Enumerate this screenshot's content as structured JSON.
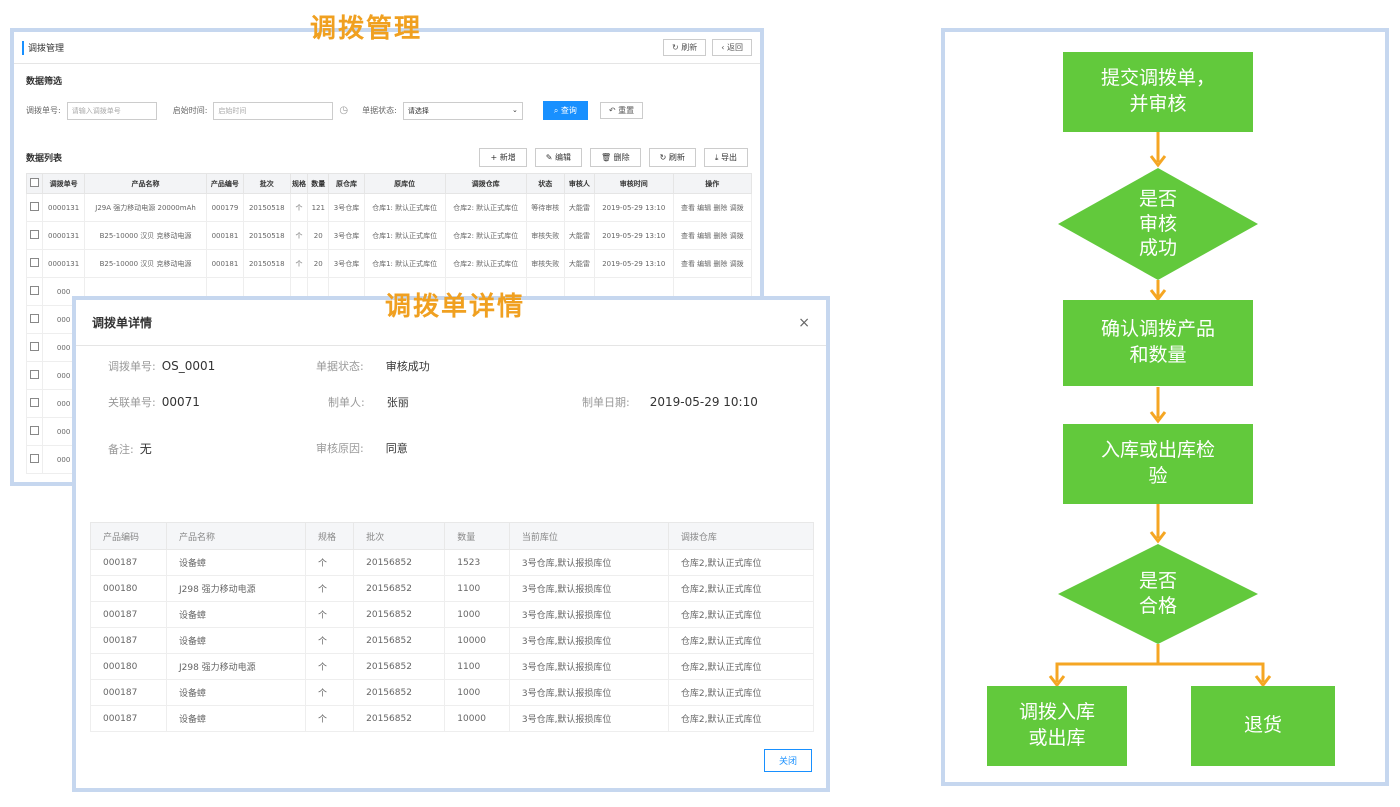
{
  "captions": {
    "top": "调拨管理",
    "middle": "调拨单详情"
  },
  "back_window": {
    "title": "调拨管理",
    "refresh": "刷新",
    "back": "返回",
    "filter_section": "数据筛选",
    "filter": {
      "code_label": "调拨单号:",
      "code_placeholder": "请输入调拨单号",
      "start_label": "启始时间:",
      "start_placeholder": "启始时间",
      "status_label": "单据状态:",
      "status_value": "请选择",
      "search": "查询",
      "reset": "重置"
    },
    "list_section": "数据列表",
    "toolbar": [
      "新增",
      "编辑",
      "删除",
      "刷新",
      "导出"
    ],
    "columns": [
      "",
      "调拨单号",
      "产品名称",
      "产品编号",
      "批次",
      "规格",
      "数量",
      "原仓库",
      "原库位",
      "调拨仓库",
      "状态",
      "审核人",
      "审核时间",
      "操作"
    ],
    "rows": [
      {
        "code": "0000131",
        "name": "J29A 强力移动电源 20000mAh",
        "pcode": "000179",
        "batch": "20150518",
        "spec": "个",
        "qty": "121",
        "wh": "3号仓库",
        "loc": "仓库1: 默认正式库位",
        "target": "仓库2: 默认正式库位",
        "status": "等待审核",
        "auditor": "大能雷",
        "time": "2019-05-29 13:10",
        "ops": "查看 编辑 删除 调拨"
      },
      {
        "code": "0000131",
        "name": "B25-10000 汉贝 克移动电源",
        "pcode": "000181",
        "batch": "20150518",
        "spec": "个",
        "qty": "20",
        "wh": "3号仓库",
        "loc": "仓库1: 默认正式库位",
        "target": "仓库2: 默认正式库位",
        "status": "审核失败",
        "auditor": "大能雷",
        "time": "2019-05-29 13:10",
        "ops": "查看 编辑 删除 调拨"
      },
      {
        "code": "0000131",
        "name": "B25-10000 汉贝 克移动电源",
        "pcode": "000181",
        "batch": "20150518",
        "spec": "个",
        "qty": "20",
        "wh": "3号仓库",
        "loc": "仓库1: 默认正式库位",
        "target": "仓库2: 默认正式库位",
        "status": "审核失败",
        "auditor": "大能雷",
        "time": "2019-05-29 13:10",
        "ops": "查看 编辑 删除 调拨"
      },
      {
        "code": "000",
        "name": "",
        "pcode": "",
        "batch": "",
        "spec": "",
        "qty": "",
        "wh": "",
        "loc": "",
        "target": "",
        "status": "",
        "auditor": "",
        "time": "",
        "ops": ""
      },
      {
        "code": "000",
        "name": "",
        "pcode": "",
        "batch": "",
        "spec": "",
        "qty": "",
        "wh": "",
        "loc": "",
        "target": "",
        "status": "",
        "auditor": "",
        "time": "",
        "ops": ""
      },
      {
        "code": "000",
        "name": "",
        "pcode": "",
        "batch": "",
        "spec": "",
        "qty": "",
        "wh": "",
        "loc": "",
        "target": "",
        "status": "",
        "auditor": "",
        "time": "",
        "ops": ""
      },
      {
        "code": "000",
        "name": "",
        "pcode": "",
        "batch": "",
        "spec": "",
        "qty": "",
        "wh": "",
        "loc": "",
        "target": "",
        "status": "",
        "auditor": "",
        "time": "",
        "ops": ""
      },
      {
        "code": "000",
        "name": "",
        "pcode": "",
        "batch": "",
        "spec": "",
        "qty": "",
        "wh": "",
        "loc": "",
        "target": "",
        "status": "",
        "auditor": "",
        "time": "",
        "ops": ""
      },
      {
        "code": "000",
        "name": "",
        "pcode": "",
        "batch": "",
        "spec": "",
        "qty": "",
        "wh": "",
        "loc": "",
        "target": "",
        "status": "",
        "auditor": "",
        "time": "",
        "ops": ""
      },
      {
        "code": "000",
        "name": "",
        "pcode": "",
        "batch": "",
        "spec": "",
        "qty": "",
        "wh": "",
        "loc": "",
        "target": "",
        "status": "",
        "auditor": "",
        "time": "",
        "ops": ""
      }
    ]
  },
  "detail": {
    "title": "调拨单详情",
    "close_icon": "×",
    "fields": {
      "code_label": "调拨单号:",
      "code_value": "OS_0001",
      "status_label": "单据状态:",
      "status_value": "审核成功",
      "rel_label": "关联单号:",
      "rel_value": "00071",
      "maker_label": "制单人:",
      "maker_value": "张丽",
      "date_label": "制单日期:",
      "date_value": "2019-05-29 10:10",
      "note_label": "备注:",
      "note_value": "无",
      "reason_label": "审核原因:",
      "reason_value": "同意"
    },
    "columns": [
      "产品编码",
      "产品名称",
      "规格",
      "批次",
      "数量",
      "当前库位",
      "调拨仓库"
    ],
    "rows": [
      [
        "000187",
        "设备蟑",
        "个",
        "20156852",
        "1523",
        "3号仓库,默认报损库位",
        "仓库2,默认正式库位"
      ],
      [
        "000180",
        "J298 强力移动电源",
        "个",
        "20156852",
        "1100",
        "3号仓库,默认报损库位",
        "仓库2,默认正式库位"
      ],
      [
        "000187",
        "设备蟑",
        "个",
        "20156852",
        "1000",
        "3号仓库,默认报损库位",
        "仓库2,默认正式库位"
      ],
      [
        "000187",
        "设备蟑",
        "个",
        "20156852",
        "10000",
        "3号仓库,默认报损库位",
        "仓库2,默认正式库位"
      ],
      [
        "000180",
        "J298 强力移动电源",
        "个",
        "20156852",
        "1100",
        "3号仓库,默认报损库位",
        "仓库2,默认正式库位"
      ],
      [
        "000187",
        "设备蟑",
        "个",
        "20156852",
        "1000",
        "3号仓库,默认报损库位",
        "仓库2,默认正式库位"
      ],
      [
        "000187",
        "设备蟑",
        "个",
        "20156852",
        "10000",
        "3号仓库,默认报损库位",
        "仓库2,默认正式库位"
      ]
    ],
    "close_button": "关闭"
  },
  "flow": {
    "green": "#62c93c",
    "arrow": "#f5a623",
    "n1": "提交调拨单，\n并审核",
    "d1": "是否\n审核\n成功",
    "n2": "确认调拨产品\n和数量",
    "n3": "入库或出库检\n验",
    "d2": "是否\n合格",
    "n4": "调拨入库\n或出库",
    "n5": "退货"
  }
}
